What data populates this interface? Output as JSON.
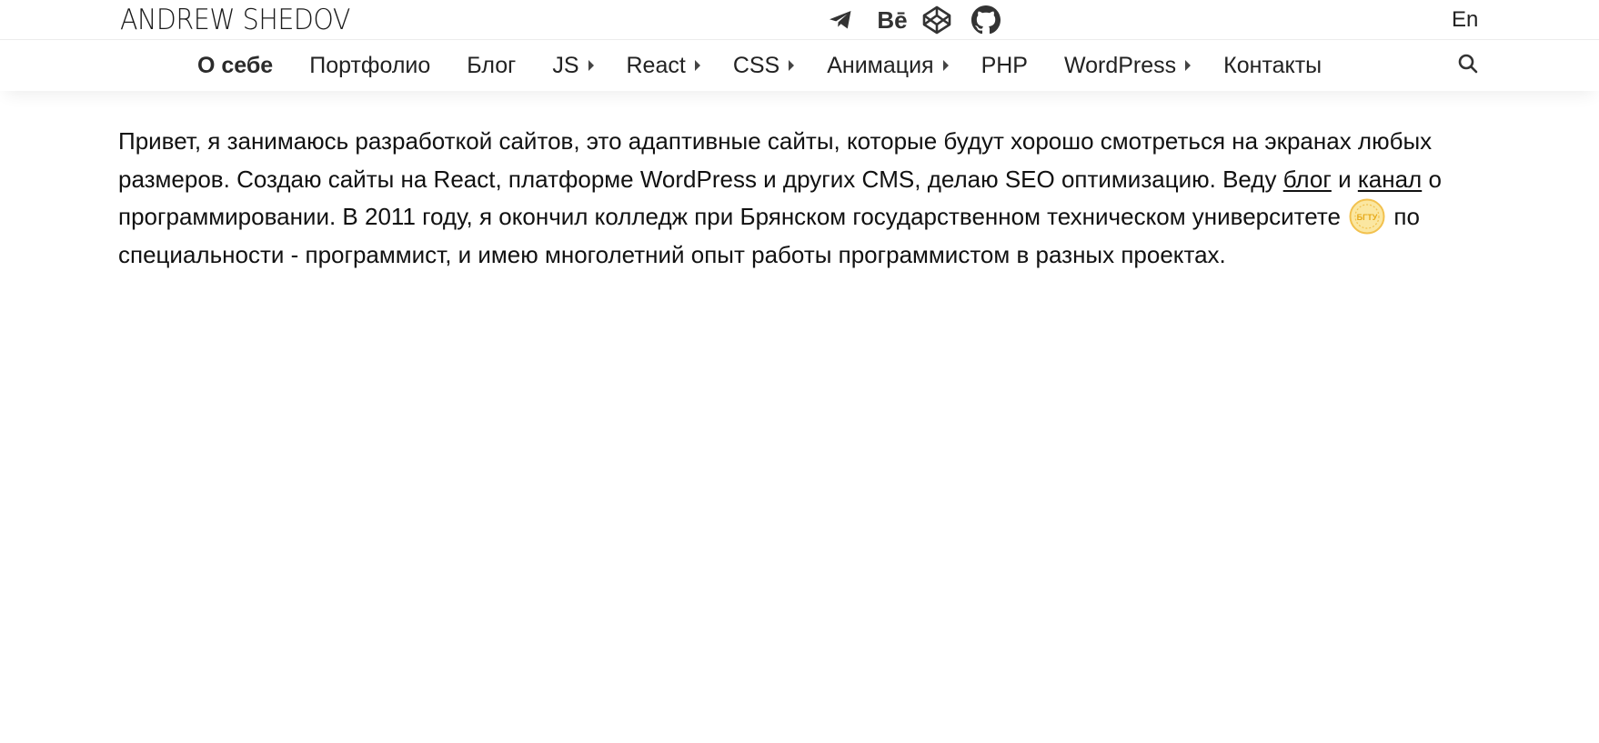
{
  "header": {
    "logo": "ANDREW SHEDOV",
    "socials": [
      {
        "name": "telegram",
        "icon": "telegram-icon"
      },
      {
        "name": "behance",
        "icon": "behance-icon",
        "label": "Bē"
      },
      {
        "name": "codepen",
        "icon": "codepen-icon"
      },
      {
        "name": "github",
        "icon": "github-icon"
      }
    ],
    "language": "En"
  },
  "nav": {
    "items": [
      {
        "label": "О себе",
        "active": true,
        "has_submenu": false
      },
      {
        "label": "Портфолио",
        "active": false,
        "has_submenu": false
      },
      {
        "label": "Блог",
        "active": false,
        "has_submenu": false
      },
      {
        "label": "JS",
        "active": false,
        "has_submenu": true
      },
      {
        "label": "React",
        "active": false,
        "has_submenu": true
      },
      {
        "label": "CSS",
        "active": false,
        "has_submenu": true
      },
      {
        "label": "Анимация",
        "active": false,
        "has_submenu": true
      },
      {
        "label": "PHP",
        "active": false,
        "has_submenu": false
      },
      {
        "label": "WordPress",
        "active": false,
        "has_submenu": true
      },
      {
        "label": "Контакты",
        "active": false,
        "has_submenu": false
      }
    ],
    "search_icon": "search-icon"
  },
  "about": {
    "text_1": "Привет, я занимаюсь разработкой сайтов, это адаптивные сайты, которые будут хорошо смотреться на экранах любых размеров. Создаю сайты на React, платформе WordPress и других CMS, делаю SEO оптимизацию. Веду ",
    "link_blog": "блог",
    "text_2": " и ",
    "link_channel": "канал",
    "text_3": " о программировании. В 2011 году, я окончил колледж при Брянском государственном техническом университете ",
    "university_logo_text": "БГТУ",
    "text_4": " по специальности - программист, и имею многолетний опыт работы программистом в разных проектах."
  },
  "colors": {
    "text": "#111111",
    "nav_text": "#222222",
    "university_logo": "#f2c14e"
  }
}
